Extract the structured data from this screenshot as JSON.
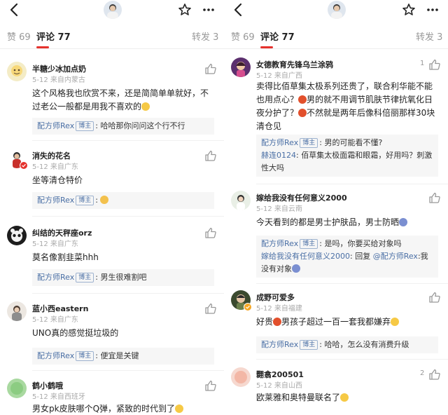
{
  "colors": {
    "accent": "#e5322d",
    "link": "#4a6fa5"
  },
  "panels": [
    {
      "tabs": [
        {
          "label": "赞 69"
        },
        {
          "label": "评论 77"
        },
        {
          "label": "转发 3"
        }
      ],
      "comments": [
        {
          "name": "半糖少冰加点奶",
          "meta": "5-12  来自内蒙古",
          "text": "这个风格我也欣赏不来，还是简简单单就好，不过老公一般都是用我不喜欢的",
          "reply": {
            "author": "配方师Rex",
            "badge": "博主",
            "text": ": 哈哈那你问问这个行不行"
          }
        },
        {
          "name": "消失的花名",
          "meta": "5-12  来自广东",
          "text": "坐等清仓特价",
          "reply": {
            "author": "配方师Rex",
            "badge": "博主",
            "text": ": "
          }
        },
        {
          "name": "纠结的天秤座orz",
          "meta": "5-12  来自广东",
          "text": "莫名像割韭菜hhh",
          "reply": {
            "author": "配方师Rex",
            "badge": "博主",
            "text": ": 男生很难割吧"
          }
        },
        {
          "name": "蓝小西eastern",
          "meta": "5-12  来自广东",
          "text": "UNO真的感觉挺垃圾的",
          "reply": {
            "author": "配方师Rex",
            "badge": "博主",
            "text": ": 便宜是关键"
          }
        },
        {
          "name": "鹤小鹤哦",
          "meta": "5-12  来自西班牙",
          "text": "男女pk皮肤哪个Q弹，紧致的时代到了"
        }
      ]
    },
    {
      "tabs": [
        {
          "label": "赞 69"
        },
        {
          "label": "评论 77"
        },
        {
          "label": "转发 3"
        }
      ],
      "comments": [
        {
          "name": "女德教育先锋乌兰涂鸦",
          "meta": "5-12  来自广西",
          "likes": "1",
          "text_a": "卖得比佰草集太极系列还贵了，联合利华能不能也用点心？",
          "text_b": "男的就不用调节肌肤节律抗氧化日夜分护了？",
          "text_c": "不然就是两年后像科倍丽那样30块清仓见",
          "reply": {
            "author": "配方师Rex",
            "badge": "博主",
            "text": ": 男的可能看不懂?"
          },
          "reply2": {
            "author": "赫连0124",
            "text": ": 佰草集太极面霜和眼霜，好用吗？刺激性大吗"
          }
        },
        {
          "name": "嫁给我没有任何意义2000",
          "meta": "5-12  来自云南",
          "text": "今天看到的都是男士护肤品，男士防晒",
          "reply": {
            "author": "配方师Rex",
            "badge": "博主",
            "text": ": 是吗，你要买给对象吗"
          },
          "reply2": {
            "author": "嫁给我没有任何意义2000",
            "text_a": ": 回复 ",
            "mention": "@配方师Rex",
            "text_b": ":我没有对象"
          }
        },
        {
          "name": "成野可爱多",
          "meta": "5-12  来自福建",
          "text_a": "好贵",
          "text_b": "男孩子超过一百一套我都嫌弃",
          "reply": {
            "author": "配方师Rex",
            "badge": "博主",
            "text": ": 哈哈，怎么没有消费升级"
          }
        },
        {
          "name": "翾翕200501",
          "meta": "5-12  来自山西",
          "likes": "2",
          "text": "欧莱雅和奥特曼联名了"
        }
      ]
    }
  ]
}
